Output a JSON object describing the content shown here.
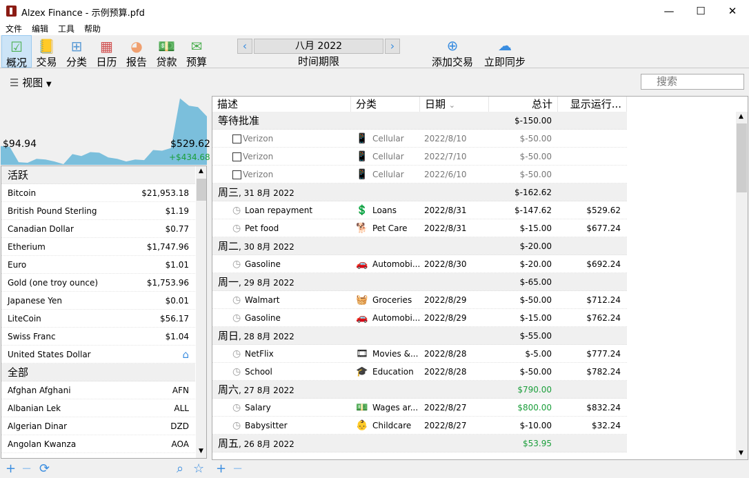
{
  "window": {
    "title": "Alzex Finance - 示例预算.pfd",
    "minimize": "—",
    "maximize": "☐",
    "close": "✕"
  },
  "menu": [
    "文件",
    "编辑",
    "工具",
    "帮助"
  ],
  "toolbar": [
    {
      "label": "概况",
      "icon": "overview-calendar-check-icon",
      "glyph": "☑",
      "color": "#4caf50",
      "active": true
    },
    {
      "label": "交易",
      "icon": "transactions-ledger-icon",
      "glyph": "📒",
      "color": "#e05050"
    },
    {
      "label": "分类",
      "icon": "categories-tree-icon",
      "glyph": "⊞",
      "color": "#5b9bd5"
    },
    {
      "label": "日历",
      "icon": "calendar-icon",
      "glyph": "▦",
      "color": "#d05050"
    },
    {
      "label": "报告",
      "icon": "reports-pie-icon",
      "glyph": "◕",
      "color": "#f0a070"
    },
    {
      "label": "贷款",
      "icon": "loans-money-icon",
      "glyph": "💵",
      "color": "#4caf50"
    },
    {
      "label": "预算",
      "icon": "budget-envelope-icon",
      "glyph": "✉",
      "color": "#4caf50"
    }
  ],
  "period": {
    "prev": "‹",
    "month": "八月 2022",
    "next": "›",
    "label": "时间期限"
  },
  "actions": {
    "add": "添加交易",
    "sync": "立即同步"
  },
  "view": {
    "label": "视图"
  },
  "search": {
    "placeholder": "搜索"
  },
  "chart": {
    "start_value": "$94.94",
    "end_value": "$529.62",
    "change": "+$434.68",
    "fill_color": "#7bbfdc"
  },
  "chart_data": {
    "type": "area",
    "values": [
      95,
      85,
      -142,
      -152,
      -93,
      -103,
      -132,
      -172,
      -24,
      -53,
      6,
      -4,
      -73,
      -93,
      -132,
      -103,
      -112,
      36,
      26,
      65,
      796,
      688,
      668,
      530
    ]
  },
  "accounts": {
    "active_label": "活跃",
    "active": [
      [
        "Bitcoin",
        "$21,953.18"
      ],
      [
        "British Pound Sterling",
        "$1.19"
      ],
      [
        "Canadian Dollar",
        "$0.77"
      ],
      [
        "Etherium",
        "$1,747.96"
      ],
      [
        "Euro",
        "$1.01"
      ],
      [
        "Gold (one troy ounce)",
        "$1,753.96"
      ],
      [
        "Japanese Yen",
        "$0.01"
      ],
      [
        "LiteCoin",
        "$56.17"
      ],
      [
        "Swiss Franc",
        "$1.04"
      ],
      [
        "United States Dollar",
        "⌂"
      ]
    ],
    "all_label": "全部",
    "all": [
      [
        "Afghan Afghani",
        "AFN"
      ],
      [
        "Albanian Lek",
        "ALL"
      ],
      [
        "Algerian Dinar",
        "DZD"
      ],
      [
        "Angolan Kwanza",
        "AOA"
      ]
    ]
  },
  "columns": [
    "描述",
    "分类",
    "日期",
    "总计",
    "显示运行..."
  ],
  "sort_indicator": "⌄",
  "rows": [
    {
      "g": 1,
      "d": "等待批准",
      "t": "$-150.00"
    },
    {
      "p": 1,
      "d": "Verizon",
      "c": "Cellular",
      "ci": "📱",
      "dt": "2022/8/10",
      "t": "$-50.00"
    },
    {
      "p": 1,
      "d": "Verizon",
      "c": "Cellular",
      "ci": "📱",
      "dt": "2022/7/10",
      "t": "$-50.00"
    },
    {
      "p": 1,
      "d": "Verizon",
      "c": "Cellular",
      "ci": "📱",
      "dt": "2022/6/10",
      "t": "$-50.00"
    },
    {
      "g": 1,
      "d": "周三",
      "d2": ", 31 8月 2022",
      "t": "$-162.62"
    },
    {
      "d": "Loan repayment",
      "c": "Loans",
      "ci": "💲",
      "dt": "2022/8/31",
      "t": "$-147.62",
      "r": "$529.62"
    },
    {
      "d": "Pet food",
      "c": "Pet Care",
      "ci": "🐕",
      "dt": "2022/8/31",
      "t": "$-15.00",
      "r": "$677.24"
    },
    {
      "g": 1,
      "d": "周二",
      "d2": ", 30 8月 2022",
      "t": "$-20.00"
    },
    {
      "d": "Gasoline",
      "c": "Automobi...",
      "ci": "🚗",
      "dt": "2022/8/30",
      "t": "$-20.00",
      "r": "$692.24"
    },
    {
      "g": 1,
      "d": "周一",
      "d2": ", 29 8月 2022",
      "t": "$-65.00"
    },
    {
      "d": "Walmart",
      "c": "Groceries",
      "ci": "🧺",
      "dt": "2022/8/29",
      "t": "$-50.00",
      "r": "$712.24"
    },
    {
      "d": "Gasoline",
      "c": "Automobi...",
      "ci": "🚗",
      "dt": "2022/8/29",
      "t": "$-15.00",
      "r": "$762.24"
    },
    {
      "g": 1,
      "d": "周日",
      "d2": ", 28 8月 2022",
      "t": "$-55.00"
    },
    {
      "d": "NetFlix",
      "c": "Movies &...",
      "ci": "🎞",
      "dt": "2022/8/28",
      "t": "$-5.00",
      "r": "$777.24"
    },
    {
      "d": "School",
      "c": "Education",
      "ci": "🎓",
      "dt": "2022/8/28",
      "t": "$-50.00",
      "r": "$782.24"
    },
    {
      "g": 1,
      "d": "周六",
      "d2": ", 27 8月 2022",
      "t": "$790.00",
      "pos": 1
    },
    {
      "d": "Salary",
      "c": "Wages ar...",
      "ci": "💵",
      "dt": "2022/8/27",
      "t": "$800.00",
      "pos": 1,
      "r": "$832.24"
    },
    {
      "d": "Babysitter",
      "c": "Childcare",
      "ci": "👶",
      "dt": "2022/8/27",
      "t": "$-10.00",
      "r": "$32.24"
    },
    {
      "g": 1,
      "d": "周五",
      "d2": ", 26 8月 2022",
      "t": "$53.95",
      "pos": 1
    }
  ],
  "bottom": {
    "add": "+",
    "remove": "−",
    "sync": "⟳",
    "find": "⌕",
    "favorite": "☆"
  }
}
